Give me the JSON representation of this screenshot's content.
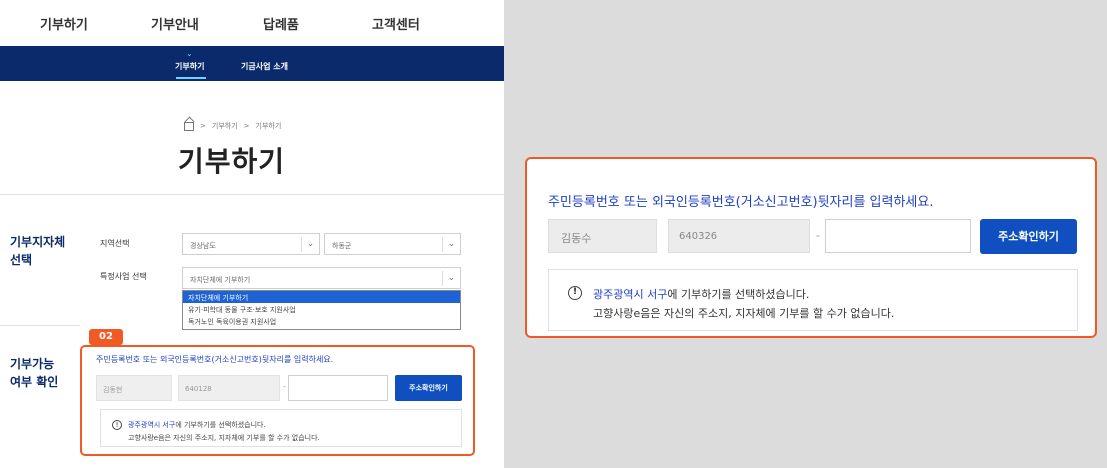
{
  "gnb": {
    "items": [
      "기부하기",
      "기부안내",
      "답례품",
      "고객센터"
    ]
  },
  "subnav": {
    "items": [
      "기부하기",
      "기금사업 소개"
    ],
    "caret": "⌄"
  },
  "breadcrumb": {
    "items": [
      "기부하기",
      "기부하기"
    ],
    "separator": ">"
  },
  "page_title": "기부하기",
  "section1": {
    "title_line1": "기부지자체",
    "title_line2": "선택",
    "region_label": "지역선택",
    "region_value": "경상남도",
    "district_value": "하동군",
    "project_label": "특정사업 선택",
    "project_value": "자치단체에 기부하기",
    "options": [
      "자치단체에 기부하기",
      "유기·피학대 동물 구조·보호 지원사업",
      "독거노인 독육이용권 지원사업"
    ]
  },
  "section2": {
    "badge": "02",
    "title_line1": "기부가능",
    "title_line2": "여부 확인",
    "instruction": "주민등록번호 또는 외국인등록번호(거소신고번호)뒷자리를 입력하세요.",
    "name_value": "김동현",
    "rrn_front_value": "640128",
    "dash": "-",
    "button_label": "주소확인하기",
    "notice_region": "광주광역시 서구",
    "notice_line1_rest": "에 기부하기를 선택하셨습니다.",
    "notice_line2": "고향사랑e음은 자신의 주소지, 지자체에 기부를 할 수가 없습니다."
  },
  "zoom": {
    "instruction": "주민등록번호 또는 외국인등록번호(거소신고번호)뒷자리를 입력하세요.",
    "name_value": "김동수",
    "rrn_front_value": "640326",
    "dash": "-",
    "button_label": "주소확인하기",
    "notice_icon": "!",
    "notice_region": "광주광역시 서구",
    "notice_line1_rest": "에 기부하기를 선택하셨습니다.",
    "notice_line2": "고향사랑e음은 자신의 주소지, 지자체에 기부를 할 수가 없습니다."
  },
  "colors": {
    "navy": "#0b2a6b",
    "accent_blue": "#0f4fbf",
    "link_blue": "#1e3fc4",
    "highlight_orange": "#f05a24"
  }
}
